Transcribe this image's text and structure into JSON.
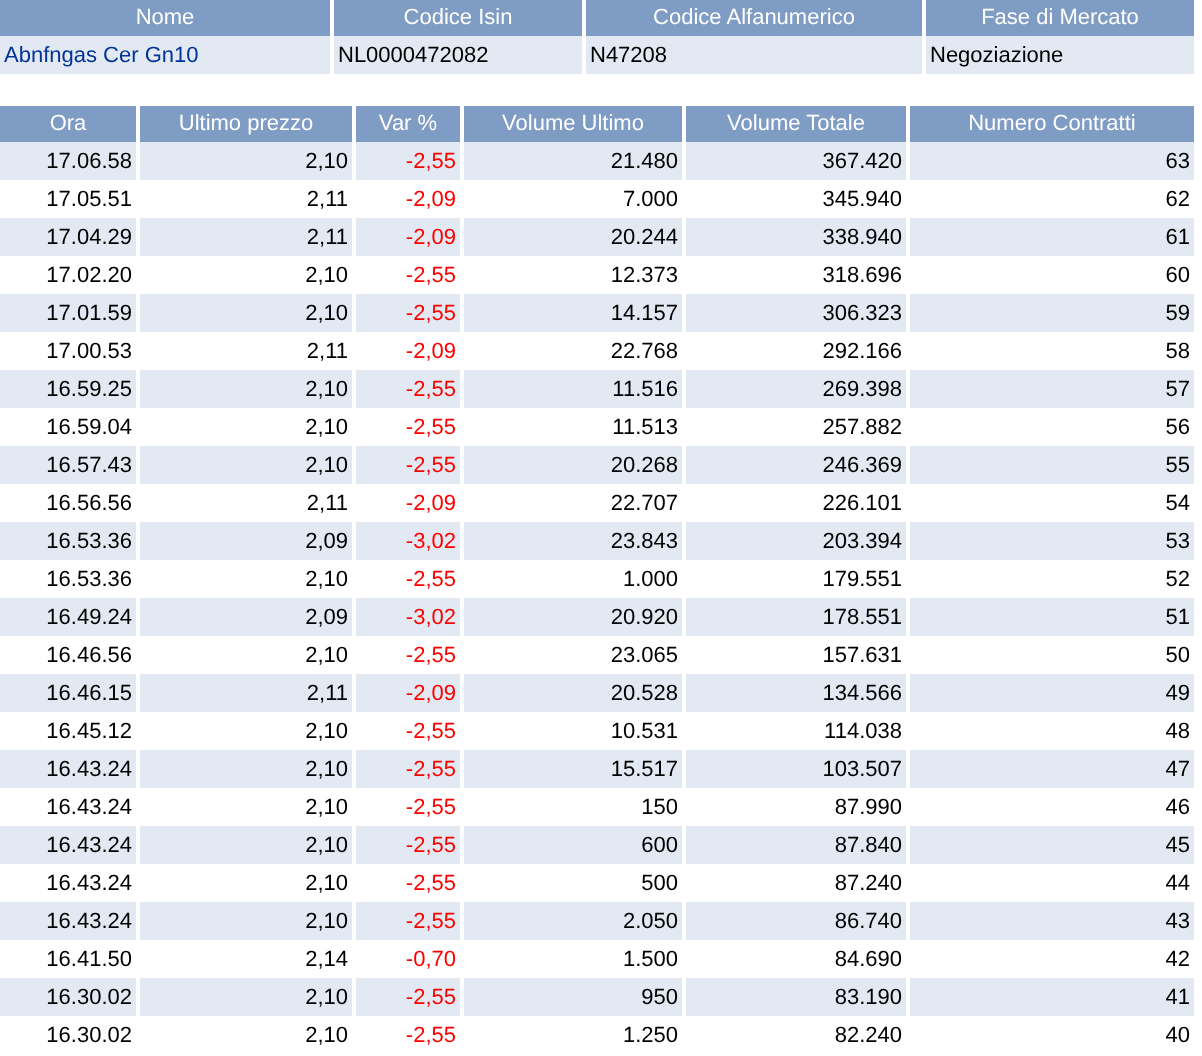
{
  "instrument": {
    "columns": [
      "Nome",
      "Codice Isin",
      "Codice Alfanumerico",
      "Fase di Mercato"
    ],
    "name": "Abnfngas Cer Gn10",
    "isin": "NL0000472082",
    "code": "N47208",
    "phase": "Negoziazione"
  },
  "trades": {
    "columns": [
      "Ora",
      "Ultimo prezzo",
      "Var %",
      "Volume Ultimo",
      "Volume Totale",
      "Numero Contratti"
    ],
    "rows": [
      [
        "17.06.58",
        "2,10",
        "-2,55",
        "21.480",
        "367.420",
        "63"
      ],
      [
        "17.05.51",
        "2,11",
        "-2,09",
        "7.000",
        "345.940",
        "62"
      ],
      [
        "17.04.29",
        "2,11",
        "-2,09",
        "20.244",
        "338.940",
        "61"
      ],
      [
        "17.02.20",
        "2,10",
        "-2,55",
        "12.373",
        "318.696",
        "60"
      ],
      [
        "17.01.59",
        "2,10",
        "-2,55",
        "14.157",
        "306.323",
        "59"
      ],
      [
        "17.00.53",
        "2,11",
        "-2,09",
        "22.768",
        "292.166",
        "58"
      ],
      [
        "16.59.25",
        "2,10",
        "-2,55",
        "11.516",
        "269.398",
        "57"
      ],
      [
        "16.59.04",
        "2,10",
        "-2,55",
        "11.513",
        "257.882",
        "56"
      ],
      [
        "16.57.43",
        "2,10",
        "-2,55",
        "20.268",
        "246.369",
        "55"
      ],
      [
        "16.56.56",
        "2,11",
        "-2,09",
        "22.707",
        "226.101",
        "54"
      ],
      [
        "16.53.36",
        "2,09",
        "-3,02",
        "23.843",
        "203.394",
        "53"
      ],
      [
        "16.53.36",
        "2,10",
        "-2,55",
        "1.000",
        "179.551",
        "52"
      ],
      [
        "16.49.24",
        "2,09",
        "-3,02",
        "20.920",
        "178.551",
        "51"
      ],
      [
        "16.46.56",
        "2,10",
        "-2,55",
        "23.065",
        "157.631",
        "50"
      ],
      [
        "16.46.15",
        "2,11",
        "-2,09",
        "20.528",
        "134.566",
        "49"
      ],
      [
        "16.45.12",
        "2,10",
        "-2,55",
        "10.531",
        "114.038",
        "48"
      ],
      [
        "16.43.24",
        "2,10",
        "-2,55",
        "15.517",
        "103.507",
        "47"
      ],
      [
        "16.43.24",
        "2,10",
        "-2,55",
        "150",
        "87.990",
        "46"
      ],
      [
        "16.43.24",
        "2,10",
        "-2,55",
        "600",
        "87.840",
        "45"
      ],
      [
        "16.43.24",
        "2,10",
        "-2,55",
        "500",
        "87.240",
        "44"
      ],
      [
        "16.43.24",
        "2,10",
        "-2,55",
        "2.050",
        "86.740",
        "43"
      ],
      [
        "16.41.50",
        "2,14",
        "-0,70",
        "1.500",
        "84.690",
        "42"
      ],
      [
        "16.30.02",
        "2,10",
        "-2,55",
        "950",
        "83.190",
        "41"
      ],
      [
        "16.30.02",
        "2,10",
        "-2,55",
        "1.250",
        "82.240",
        "40"
      ]
    ]
  }
}
